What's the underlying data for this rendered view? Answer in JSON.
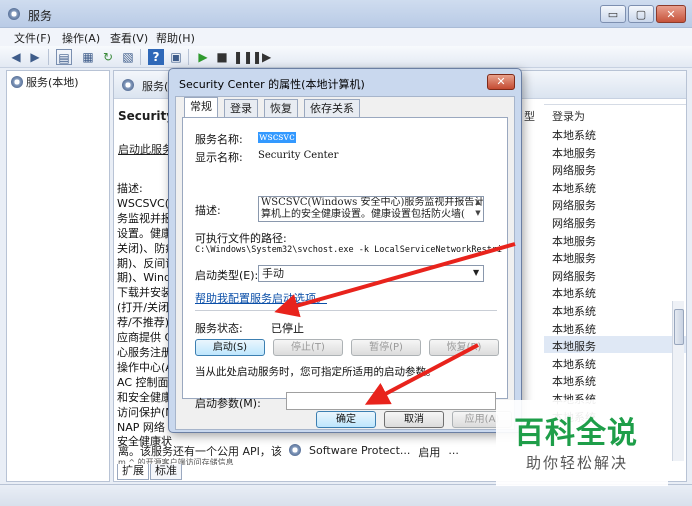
{
  "main_window": {
    "title": "服务",
    "controls": {
      "minimize": "▭",
      "maximize": "▢",
      "close": "✕"
    }
  },
  "menu": [
    "文件(F)",
    "操作(A)",
    "查看(V)",
    "帮助(H)"
  ],
  "toolbar_icons": [
    "back-arrow-icon",
    "forward-arrow-icon",
    "console-tree-icon",
    "properties-icon",
    "refresh-icon",
    "export-icon",
    "help-icon",
    "view-icon",
    "play-icon",
    "stop-icon",
    "pause-icon",
    "restart-icon"
  ],
  "tree": {
    "root": "服务(本地)"
  },
  "right_pane": {
    "header": "服务(",
    "service_title": "Security C",
    "start_link": "启动此服务",
    "desc_lines": [
      "描述:",
      "WSCSVC(W",
      "务监视并报",
      "设置。健康",
      "关闭)、防病",
      "期)、反间谍",
      "期)、Windo",
      "下载并安装",
      "(打开/关闭)",
      "荐/不推荐)",
      "应商提供 C",
      "心服务注册",
      "操作中心(A",
      "AC 控制面",
      "和安全健康",
      "访问保护(N",
      "NAP 网络",
      "安全健康状"
    ],
    "desc_tail": "离。该服务还有一个公用 API，该",
    "desc_tail2": "m ^ 的开源客户端访问存储信息",
    "col_type": "型",
    "col_logon": "登录为",
    "logon_values": [
      "本地系统",
      "本地服务",
      "网络服务",
      "本地系统",
      "网络服务",
      "网络服务",
      "本地服务",
      "本地服务",
      "网络服务",
      "本地系统",
      "本地系统",
      "本地系统",
      "本地服务",
      "本地系统",
      "本地系统",
      "本地系统",
      "本地系统"
    ],
    "highlighted_row": 12,
    "bottom_row": {
      "name": "Software Protect...",
      "status": "启用",
      "extra": "..."
    },
    "tabs": [
      "扩展",
      "标准"
    ]
  },
  "dialog": {
    "title": "Security Center 的属性(本地计算机)",
    "close": "✕",
    "tabs": [
      "常规",
      "登录",
      "恢复",
      "依存关系"
    ],
    "service_name_label": "服务名称:",
    "service_name": "wscsvc",
    "display_name_label": "显示名称:",
    "display_name": "Security Center",
    "desc_label": "描述:",
    "desc_line1": "WSCSVC(Windows 安全中心)服务监视并报告计",
    "desc_line2": "算机上的安全健康设置。健康设置包括防火墙(",
    "exe_label": "可执行文件的路径:",
    "exe_path": "C:\\Windows\\System32\\svchost.exe -k LocalServiceNetworkRestri",
    "startup_label": "启动类型(E):",
    "startup_value": "手动",
    "help_link": "帮助我配置服务启动选项。",
    "status_label": "服务状态:",
    "status_value": "已停止",
    "btn_start": "启动(S)",
    "btn_stop": "停止(T)",
    "btn_pause": "暂停(P)",
    "btn_resume": "恢复(R)",
    "hint": "当从此处启动服务时，您可指定所适用的启动参数。",
    "param_label": "启动参数(M):",
    "ok": "确定",
    "cancel": "取消",
    "apply": "应用(A)"
  },
  "watermark": {
    "big": "百科全说",
    "small": "助你轻松解决"
  },
  "colors": {
    "arrow": "#e8231c",
    "brand_green": "#1e9e49",
    "link": "#0b4fa8"
  }
}
